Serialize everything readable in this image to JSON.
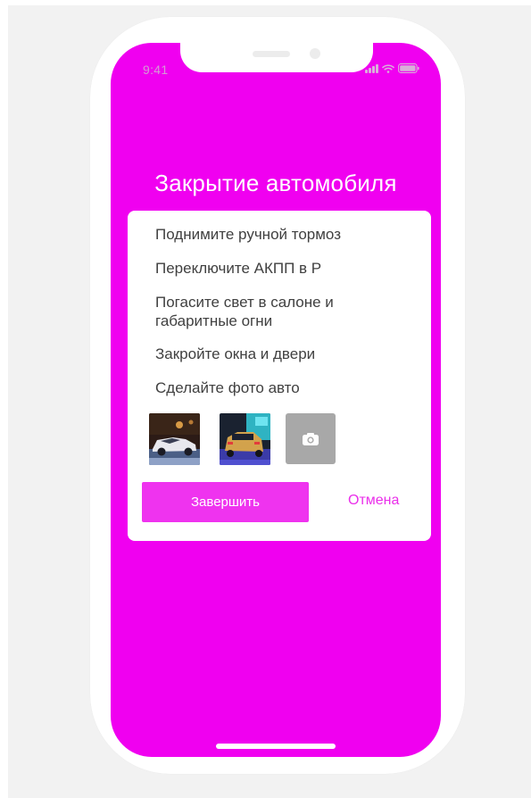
{
  "status_bar": {
    "time": "9:41",
    "icons": [
      "signal-icon",
      "wifi-icon",
      "battery-icon"
    ]
  },
  "screen": {
    "title": "Закрытие автомобиля",
    "background_color": "#f000f0"
  },
  "checklist": {
    "steps": [
      "Поднимите ручной тормоз",
      "Переключите АКПП в Р",
      "Погасите свет в салоне и\nгабаритные огни",
      "Закройте окна и двери",
      "Сделайте фото авто"
    ]
  },
  "photos": {
    "thumbnails": [
      "car-photo-1",
      "car-photo-2"
    ],
    "add_icon": "camera-icon"
  },
  "actions": {
    "finish_label": "Завершить",
    "cancel_label": "Отмена",
    "accent_color": "#ef33ef"
  }
}
